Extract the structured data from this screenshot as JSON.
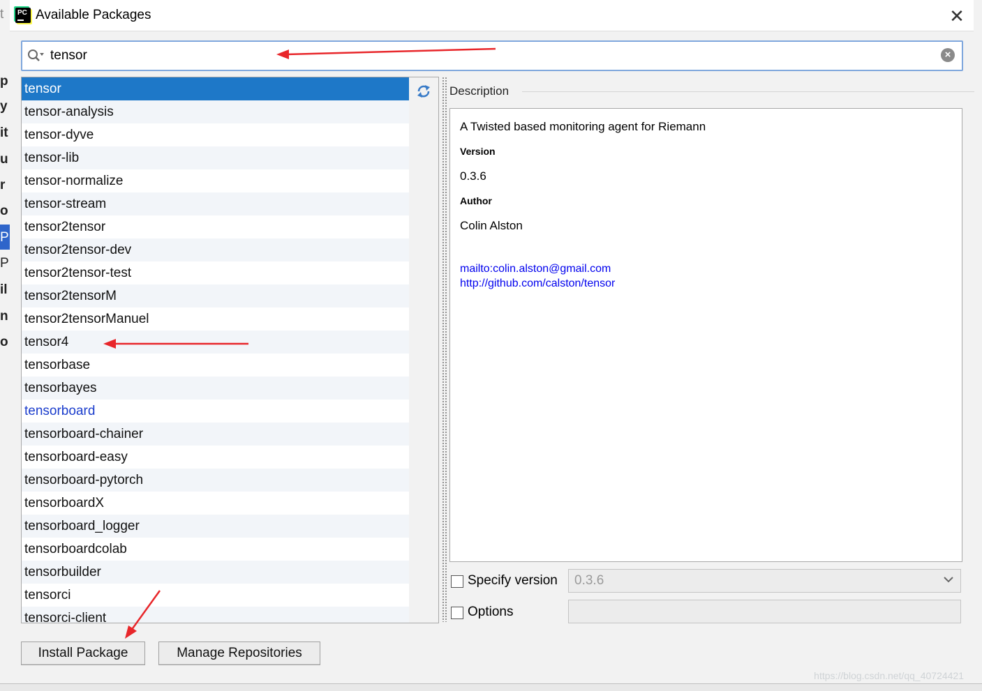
{
  "window": {
    "title": "Available Packages"
  },
  "search": {
    "value": "tensor",
    "placeholder": ""
  },
  "packages": [
    "tensor",
    "tensor-analysis",
    "tensor-dyve",
    "tensor-lib",
    "tensor-normalize",
    "tensor-stream",
    "tensor2tensor",
    "tensor2tensor-dev",
    "tensor2tensor-test",
    "tensor2tensorM",
    "tensor2tensorManuel",
    "tensor4",
    "tensorbase",
    "tensorbayes",
    "tensorboard",
    "tensorboard-chainer",
    "tensorboard-easy",
    "tensorboard-pytorch",
    "tensorboardX",
    "tensorboard_logger",
    "tensorboardcolab",
    "tensorbuilder",
    "tensorci",
    "tensorci-client"
  ],
  "selected_package": "tensor",
  "installed_package": "tensorboard",
  "description": {
    "label": "Description",
    "summary": "A Twisted based monitoring agent for Riemann",
    "version_heading": "Version",
    "version": "0.3.6",
    "author_heading": "Author",
    "author": "Colin Alston",
    "email_link": "mailto:colin.alston@gmail.com",
    "homepage_link": "http://github.com/calston/tensor"
  },
  "options": {
    "specify_version_label": "Specify version",
    "specify_version_checked": false,
    "version_value": "0.3.6",
    "options_label": "Options",
    "options_checked": false,
    "options_value": ""
  },
  "buttons": {
    "install": "Install Package",
    "manage": "Manage Repositories"
  },
  "background_fragments": [
    "t",
    "p",
    "y",
    "it",
    "u",
    "r",
    "o",
    "P",
    "P",
    "il",
    "n",
    "o"
  ],
  "watermark": "https://blog.csdn.net/qq_40724421",
  "colors": {
    "selection": "#1e78c8",
    "installed_text": "#1a3ccc",
    "link": "#0000ee",
    "annotation_arrow": "#e8262a",
    "search_border": "#7fa7dd"
  }
}
